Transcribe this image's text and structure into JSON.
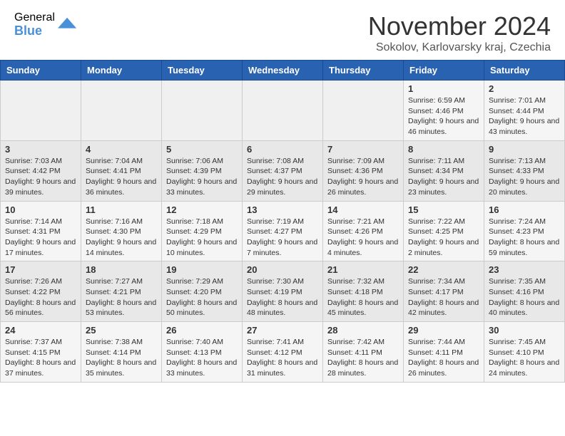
{
  "header": {
    "logo_general": "General",
    "logo_blue": "Blue",
    "month_title": "November 2024",
    "location": "Sokolov, Karlovarsky kraj, Czechia"
  },
  "weekdays": [
    "Sunday",
    "Monday",
    "Tuesday",
    "Wednesday",
    "Thursday",
    "Friday",
    "Saturday"
  ],
  "weeks": [
    [
      {
        "day": "",
        "info": ""
      },
      {
        "day": "",
        "info": ""
      },
      {
        "day": "",
        "info": ""
      },
      {
        "day": "",
        "info": ""
      },
      {
        "day": "",
        "info": ""
      },
      {
        "day": "1",
        "info": "Sunrise: 6:59 AM\nSunset: 4:46 PM\nDaylight: 9 hours and 46 minutes."
      },
      {
        "day": "2",
        "info": "Sunrise: 7:01 AM\nSunset: 4:44 PM\nDaylight: 9 hours and 43 minutes."
      }
    ],
    [
      {
        "day": "3",
        "info": "Sunrise: 7:03 AM\nSunset: 4:42 PM\nDaylight: 9 hours and 39 minutes."
      },
      {
        "day": "4",
        "info": "Sunrise: 7:04 AM\nSunset: 4:41 PM\nDaylight: 9 hours and 36 minutes."
      },
      {
        "day": "5",
        "info": "Sunrise: 7:06 AM\nSunset: 4:39 PM\nDaylight: 9 hours and 33 minutes."
      },
      {
        "day": "6",
        "info": "Sunrise: 7:08 AM\nSunset: 4:37 PM\nDaylight: 9 hours and 29 minutes."
      },
      {
        "day": "7",
        "info": "Sunrise: 7:09 AM\nSunset: 4:36 PM\nDaylight: 9 hours and 26 minutes."
      },
      {
        "day": "8",
        "info": "Sunrise: 7:11 AM\nSunset: 4:34 PM\nDaylight: 9 hours and 23 minutes."
      },
      {
        "day": "9",
        "info": "Sunrise: 7:13 AM\nSunset: 4:33 PM\nDaylight: 9 hours and 20 minutes."
      }
    ],
    [
      {
        "day": "10",
        "info": "Sunrise: 7:14 AM\nSunset: 4:31 PM\nDaylight: 9 hours and 17 minutes."
      },
      {
        "day": "11",
        "info": "Sunrise: 7:16 AM\nSunset: 4:30 PM\nDaylight: 9 hours and 14 minutes."
      },
      {
        "day": "12",
        "info": "Sunrise: 7:18 AM\nSunset: 4:29 PM\nDaylight: 9 hours and 10 minutes."
      },
      {
        "day": "13",
        "info": "Sunrise: 7:19 AM\nSunset: 4:27 PM\nDaylight: 9 hours and 7 minutes."
      },
      {
        "day": "14",
        "info": "Sunrise: 7:21 AM\nSunset: 4:26 PM\nDaylight: 9 hours and 4 minutes."
      },
      {
        "day": "15",
        "info": "Sunrise: 7:22 AM\nSunset: 4:25 PM\nDaylight: 9 hours and 2 minutes."
      },
      {
        "day": "16",
        "info": "Sunrise: 7:24 AM\nSunset: 4:23 PM\nDaylight: 8 hours and 59 minutes."
      }
    ],
    [
      {
        "day": "17",
        "info": "Sunrise: 7:26 AM\nSunset: 4:22 PM\nDaylight: 8 hours and 56 minutes."
      },
      {
        "day": "18",
        "info": "Sunrise: 7:27 AM\nSunset: 4:21 PM\nDaylight: 8 hours and 53 minutes."
      },
      {
        "day": "19",
        "info": "Sunrise: 7:29 AM\nSunset: 4:20 PM\nDaylight: 8 hours and 50 minutes."
      },
      {
        "day": "20",
        "info": "Sunrise: 7:30 AM\nSunset: 4:19 PM\nDaylight: 8 hours and 48 minutes."
      },
      {
        "day": "21",
        "info": "Sunrise: 7:32 AM\nSunset: 4:18 PM\nDaylight: 8 hours and 45 minutes."
      },
      {
        "day": "22",
        "info": "Sunrise: 7:34 AM\nSunset: 4:17 PM\nDaylight: 8 hours and 42 minutes."
      },
      {
        "day": "23",
        "info": "Sunrise: 7:35 AM\nSunset: 4:16 PM\nDaylight: 8 hours and 40 minutes."
      }
    ],
    [
      {
        "day": "24",
        "info": "Sunrise: 7:37 AM\nSunset: 4:15 PM\nDaylight: 8 hours and 37 minutes."
      },
      {
        "day": "25",
        "info": "Sunrise: 7:38 AM\nSunset: 4:14 PM\nDaylight: 8 hours and 35 minutes."
      },
      {
        "day": "26",
        "info": "Sunrise: 7:40 AM\nSunset: 4:13 PM\nDaylight: 8 hours and 33 minutes."
      },
      {
        "day": "27",
        "info": "Sunrise: 7:41 AM\nSunset: 4:12 PM\nDaylight: 8 hours and 31 minutes."
      },
      {
        "day": "28",
        "info": "Sunrise: 7:42 AM\nSunset: 4:11 PM\nDaylight: 8 hours and 28 minutes."
      },
      {
        "day": "29",
        "info": "Sunrise: 7:44 AM\nSunset: 4:11 PM\nDaylight: 8 hours and 26 minutes."
      },
      {
        "day": "30",
        "info": "Sunrise: 7:45 AM\nSunset: 4:10 PM\nDaylight: 8 hours and 24 minutes."
      }
    ]
  ]
}
